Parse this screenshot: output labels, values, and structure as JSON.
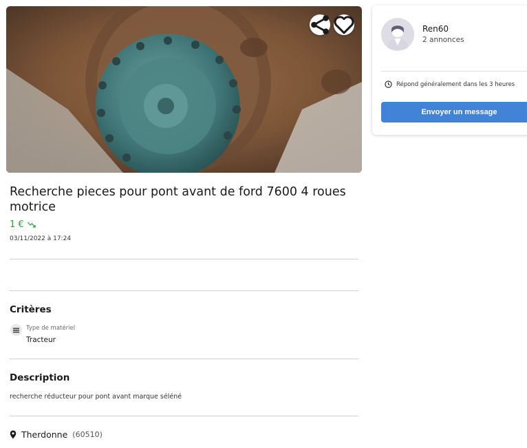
{
  "listing": {
    "title": "Recherche pieces pour pont avant de ford 7600 4 roues motrice",
    "price": "1 €",
    "date": "03/11/2022 à 17:24",
    "icons": {
      "share": "share-icon",
      "favorite": "heart-icon",
      "price_trend": "trend-down-icon"
    }
  },
  "criteria": {
    "heading": "Critères",
    "items": [
      {
        "label": "Type de matériel",
        "value": "Tracteur",
        "icon": "tractor-icon"
      }
    ]
  },
  "description": {
    "heading": "Description",
    "text": "recherche réducteur pour pont avant marque séléné"
  },
  "location": {
    "city": "Therdonne",
    "zip": "(60510)",
    "icon": "map-pin-icon"
  },
  "seller": {
    "name": "Ren60",
    "ads_count": "2 annonces",
    "response_time": "Répond généralement dans les 3 heures",
    "message_button": "Envoyer un message",
    "icons": {
      "avatar": "avatar",
      "clock": "clock-icon"
    }
  },
  "colors": {
    "price_green": "#2e9c3f",
    "button_blue": "#4183d7",
    "divider": "#cfcfcf"
  }
}
